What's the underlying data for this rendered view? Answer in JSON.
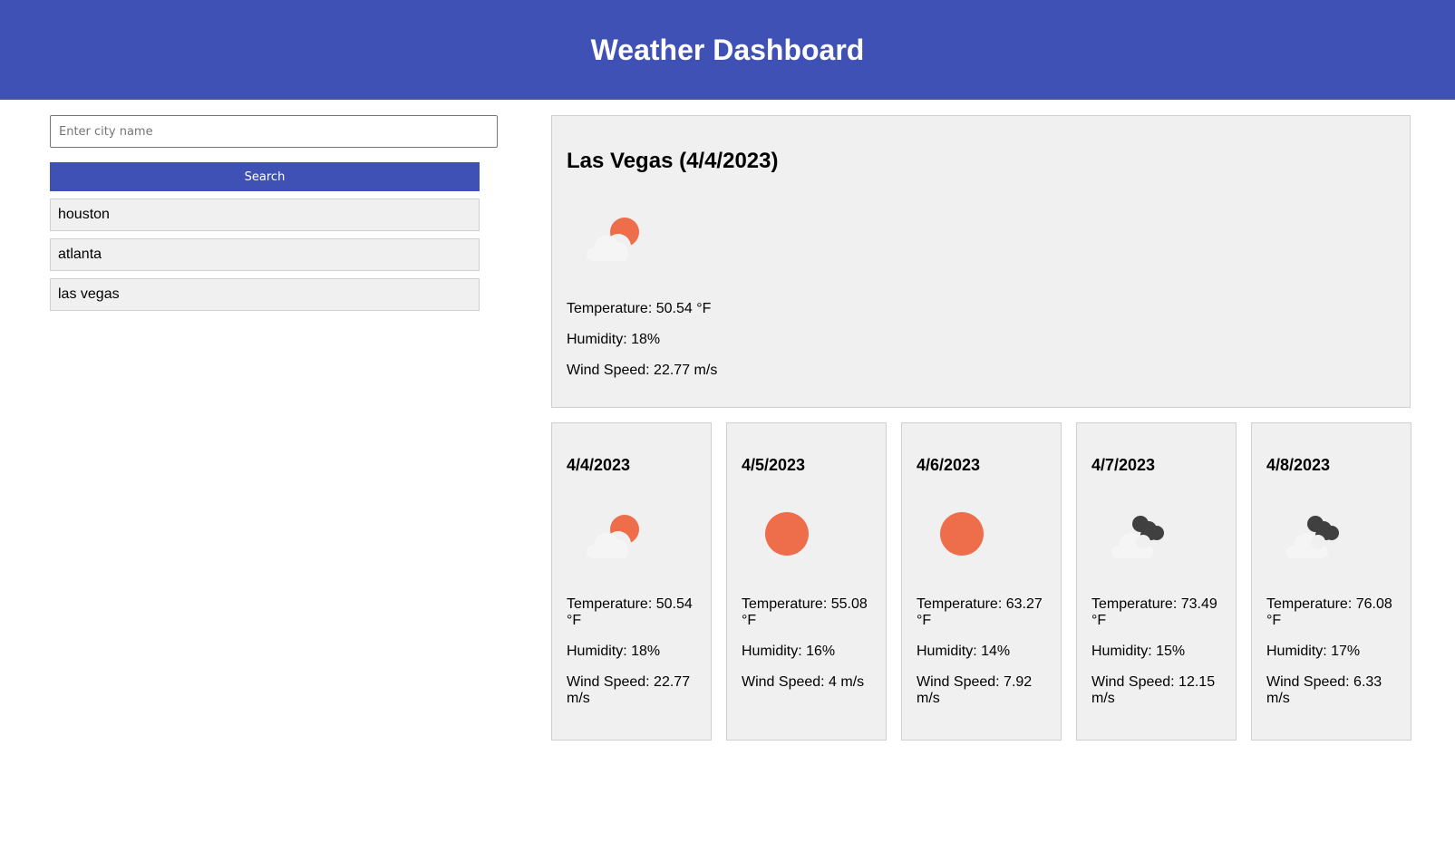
{
  "header": {
    "title": "Weather Dashboard"
  },
  "search": {
    "placeholder": "Enter city name",
    "value": "",
    "button_label": "Search"
  },
  "history": [
    {
      "label": "houston"
    },
    {
      "label": "atlanta"
    },
    {
      "label": "las vegas"
    }
  ],
  "current": {
    "title": "Las Vegas (4/4/2023)",
    "icon": "broken-clouds-day-icon",
    "temperature": "Temperature: 50.54 °F",
    "humidity": "Humidity: 18%",
    "wind": "Wind Speed: 22.77 m/s"
  },
  "forecast": [
    {
      "date": "4/4/2023",
      "icon": "broken-clouds-day-icon",
      "temperature": "Temperature: 50.54 °F",
      "humidity": "Humidity: 18%",
      "wind": "Wind Speed: 22.77 m/s"
    },
    {
      "date": "4/5/2023",
      "icon": "clear-sky-icon",
      "temperature": "Temperature: 55.08 °F",
      "humidity": "Humidity: 16%",
      "wind": "Wind Speed: 4 m/s"
    },
    {
      "date": "4/6/2023",
      "icon": "clear-sky-icon",
      "temperature": "Temperature: 63.27 °F",
      "humidity": "Humidity: 14%",
      "wind": "Wind Speed: 7.92 m/s"
    },
    {
      "date": "4/7/2023",
      "icon": "overcast-clouds-icon",
      "temperature": "Temperature: 73.49 °F",
      "humidity": "Humidity: 15%",
      "wind": "Wind Speed: 12.15 m/s"
    },
    {
      "date": "4/8/2023",
      "icon": "overcast-clouds-icon",
      "temperature": "Temperature: 76.08 °F",
      "humidity": "Humidity: 17%",
      "wind": "Wind Speed: 6.33 m/s"
    }
  ],
  "colors": {
    "header": "#3f51b5",
    "button": "#3f51b5",
    "card_bg": "#f0f0f0",
    "sun": "#ee6e4b",
    "cloud_light": "#f5f5f5",
    "cloud_dark": "#404040"
  }
}
